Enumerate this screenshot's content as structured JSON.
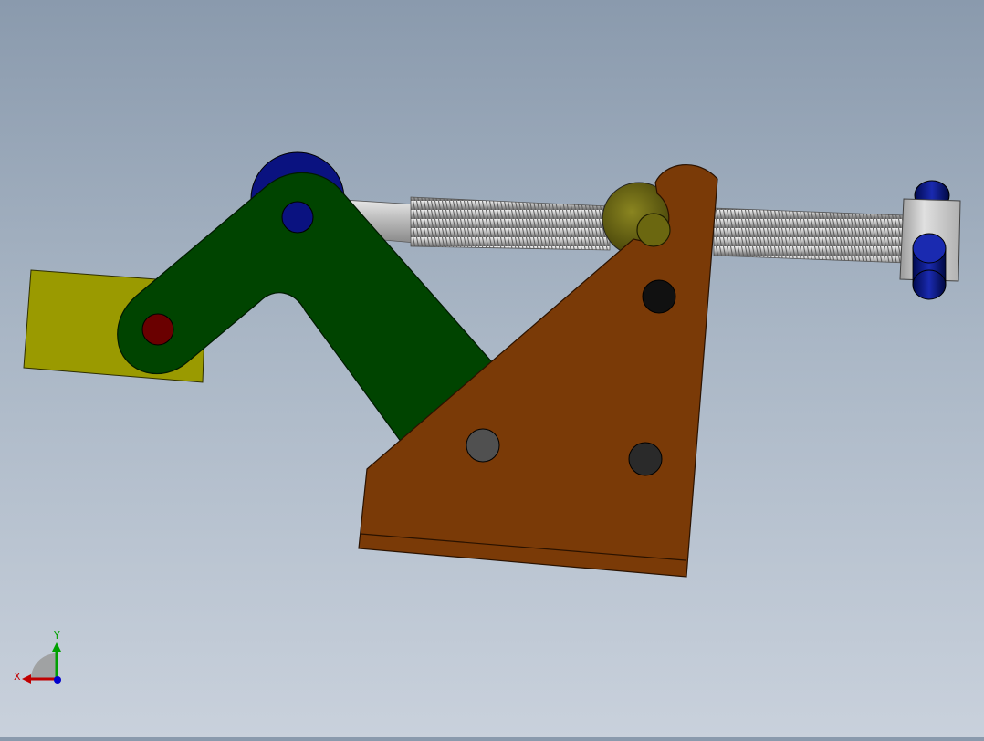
{
  "scene": {
    "colors": {
      "jaw": "#9a9a00",
      "arm": "#004400",
      "base": "#7a3a07",
      "base_edge": "#3a1a00",
      "screw_light": "#d8d8d8",
      "screw_dark": "#707070",
      "pin_blue": "#0a1280",
      "pin_red": "#6a0000",
      "nut_olive": "#5c5a0c",
      "hole_black": "#111111",
      "hole_grey": "#505050",
      "block_grey": "#c0c0c0"
    },
    "icons": {
      "triad": "xyz-axis-triad"
    }
  },
  "triad": {
    "x_label": "X",
    "y_label": "Y",
    "x_color": "#c00000",
    "y_color": "#00a000",
    "z_color": "#0000cc"
  }
}
